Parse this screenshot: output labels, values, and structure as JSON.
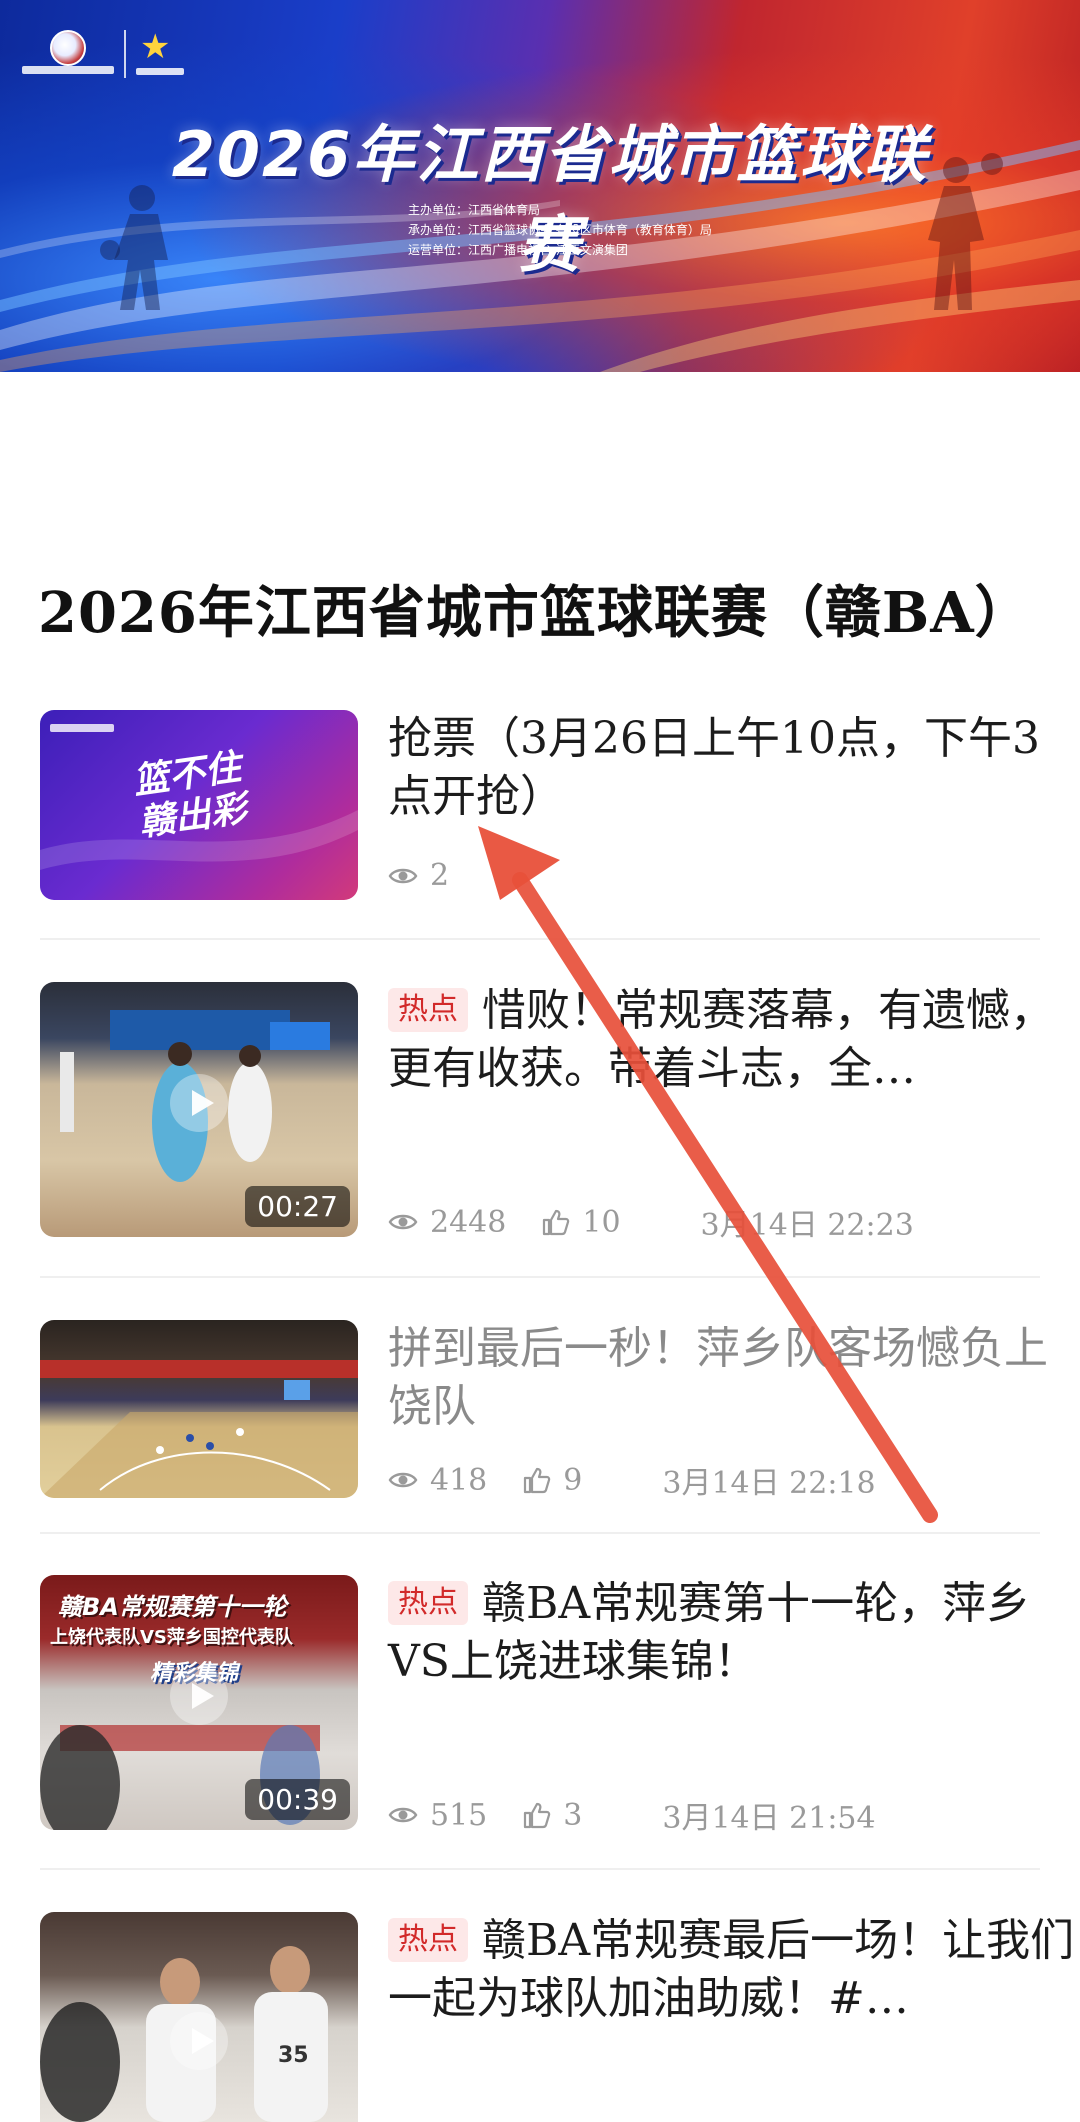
{
  "banner": {
    "title": "2026年江西省城市篮球联赛",
    "lines": [
      "主办单位：江西省体育局",
      "承办单位：江西省篮球协会  各设区市体育（教育体育）局",
      "运营单位：江西广播电视台  江西文演集团"
    ],
    "logo_left": "江西省城市篮球联赛",
    "logo_right": "江西省体育局",
    "colors": {
      "blue": "#1a3ec9",
      "red": "#e0402a"
    }
  },
  "heading": "2026年江西省城市篮球联赛（赣BA）",
  "items": [
    {
      "title": "抢票（3月26日上午10点，下午3点开抢）",
      "hot": false,
      "views": "2",
      "likes": "",
      "time": "",
      "thumb_text": "篮不住\n赣出彩",
      "duration": ""
    },
    {
      "title": "惜败！常规赛落幕，有遗憾，更有收获。带着斗志，全…",
      "hot": true,
      "hot_label": "热点",
      "views": "2448",
      "likes": "10",
      "time": "3月14日 22:23",
      "duration": "00:27"
    },
    {
      "title": "拼到最后一秒！萍乡队客场憾负上饶队",
      "hot": false,
      "views": "418",
      "likes": "9",
      "time": "3月14日 22:18",
      "duration": ""
    },
    {
      "title": "赣BA常规赛第十一轮，萍乡VS上饶进球集锦！",
      "hot": true,
      "hot_label": "热点",
      "views": "515",
      "likes": "3",
      "time": "3月14日 21:54",
      "thumb_line1": "赣BA常规赛第十一轮",
      "thumb_line2": "上饶代表队VS萍乡国控代表队",
      "thumb_line3": "精彩集锦",
      "duration": "00:39"
    },
    {
      "title": "赣BA常规赛最后一场！让我们一起为球队加油助威！#…",
      "hot": true,
      "hot_label": "热点",
      "views": "",
      "likes": "",
      "time": "",
      "duration": ""
    }
  ],
  "annotation": {
    "arrow_color": "#e8503a"
  }
}
